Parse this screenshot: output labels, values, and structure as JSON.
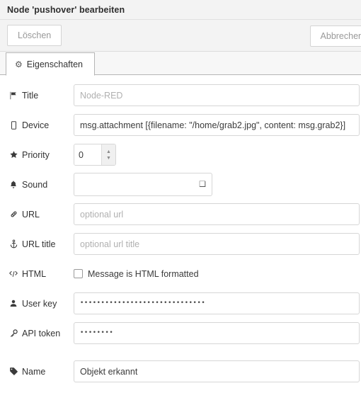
{
  "header": {
    "title": "Node 'pushover' bearbeiten"
  },
  "buttons": {
    "delete_label": "Löschen",
    "cancel_label": "Abbrechen"
  },
  "tabs": [
    {
      "label": "Eigenschaften",
      "icon": "gear-icon",
      "active": true
    }
  ],
  "form": {
    "rows": [
      {
        "key": "title",
        "icon": "flag-icon",
        "label": "Title",
        "type": "text",
        "value": "",
        "placeholder": "Node-RED"
      },
      {
        "key": "device",
        "icon": "mobile-device-icon",
        "label": "Device",
        "type": "text",
        "value": "msg.attachment [{filename: \"/home/grab2.jpg\", content: msg.grab2}]",
        "placeholder": ""
      },
      {
        "key": "priority",
        "icon": "star-icon",
        "label": "Priority",
        "type": "spinner",
        "value": "0",
        "placeholder": ""
      },
      {
        "key": "sound",
        "icon": "bell-icon",
        "label": "Sound",
        "type": "select",
        "value": "",
        "options": [
          ""
        ]
      },
      {
        "key": "url",
        "icon": "link-icon",
        "label": "URL",
        "type": "text",
        "value": "",
        "placeholder": "optional url"
      },
      {
        "key": "url_title",
        "icon": "anchor-icon",
        "label": "URL title",
        "type": "text",
        "value": "",
        "placeholder": "optional url title"
      },
      {
        "key": "html",
        "icon": "code-icon",
        "label": "HTML",
        "type": "checkbox",
        "checkbox_label": "Message is HTML formatted",
        "checked": false
      },
      {
        "key": "user_key",
        "icon": "user-icon",
        "label": "User key",
        "type": "password",
        "masked_value": "••••••••••••••••••••••••••••••"
      },
      {
        "key": "api_token",
        "icon": "key-icon",
        "label": "API token",
        "type": "password",
        "masked_value": "••••••••"
      },
      {
        "key": "name",
        "icon": "tag-icon",
        "label": "Name",
        "type": "text",
        "value": "Objekt erkannt",
        "placeholder": "",
        "extra_top_gap": true
      }
    ]
  },
  "colors": {
    "header_bg": "#f3f3f3",
    "border": "#d6d6d6",
    "text": "#333333",
    "placeholder": "#b0b0b0"
  }
}
